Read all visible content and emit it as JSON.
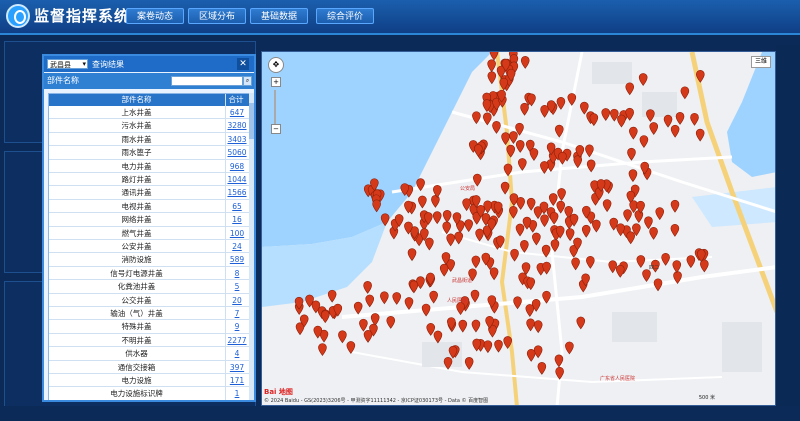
{
  "app": {
    "title": "监督指挥系统"
  },
  "nav": {
    "items": [
      "案卷动态",
      "区域分布",
      "基础数据",
      "综合评价"
    ]
  },
  "dialog": {
    "district": "武昌县",
    "title": "查询结果",
    "table_label": "部件名称",
    "columns": {
      "name": "部件名称",
      "total": "合计"
    },
    "rows": [
      {
        "name": "上水井盖",
        "count": "647"
      },
      {
        "name": "污水井盖",
        "count": "3280"
      },
      {
        "name": "雨水井盖",
        "count": "3403"
      },
      {
        "name": "雨水篦子",
        "count": "5060"
      },
      {
        "name": "电力井盖",
        "count": "968"
      },
      {
        "name": "路灯井盖",
        "count": "1044"
      },
      {
        "name": "通讯井盖",
        "count": "1566"
      },
      {
        "name": "电视井盖",
        "count": "65"
      },
      {
        "name": "网络井盖",
        "count": "16"
      },
      {
        "name": "燃气井盖",
        "count": "100"
      },
      {
        "name": "公安井盖",
        "count": "24"
      },
      {
        "name": "消防设施",
        "count": "589"
      },
      {
        "name": "信号灯电源井盖",
        "count": "8"
      },
      {
        "name": "化粪池井盖",
        "count": "5"
      },
      {
        "name": "公交井盖",
        "count": "20"
      },
      {
        "name": "输油（气）井盖",
        "count": "7"
      },
      {
        "name": "特殊井盖",
        "count": "9"
      },
      {
        "name": "不明井盖",
        "count": "2277"
      },
      {
        "name": "供水器",
        "count": "4"
      },
      {
        "name": "通信交接箱",
        "count": "397"
      },
      {
        "name": "电力设施",
        "count": "171"
      },
      {
        "name": "电力设施标识牌",
        "count": "1"
      }
    ]
  },
  "map": {
    "maptype": "三维",
    "logo": "Bai 地图",
    "attribution": "© 2024 Baidu - GS(2023)3206号 - 甲测资字11111342 - 京ICP证030173号 - Data © 百度智图",
    "scale": "500 米",
    "labels": [
      "公安局",
      "四二",
      "武昌街道",
      "广东省人民医院",
      "人民医院"
    ]
  },
  "colors": {
    "marker": "#d43a1a",
    "header": "#1e6cc7",
    "background": "#0b2a58"
  }
}
